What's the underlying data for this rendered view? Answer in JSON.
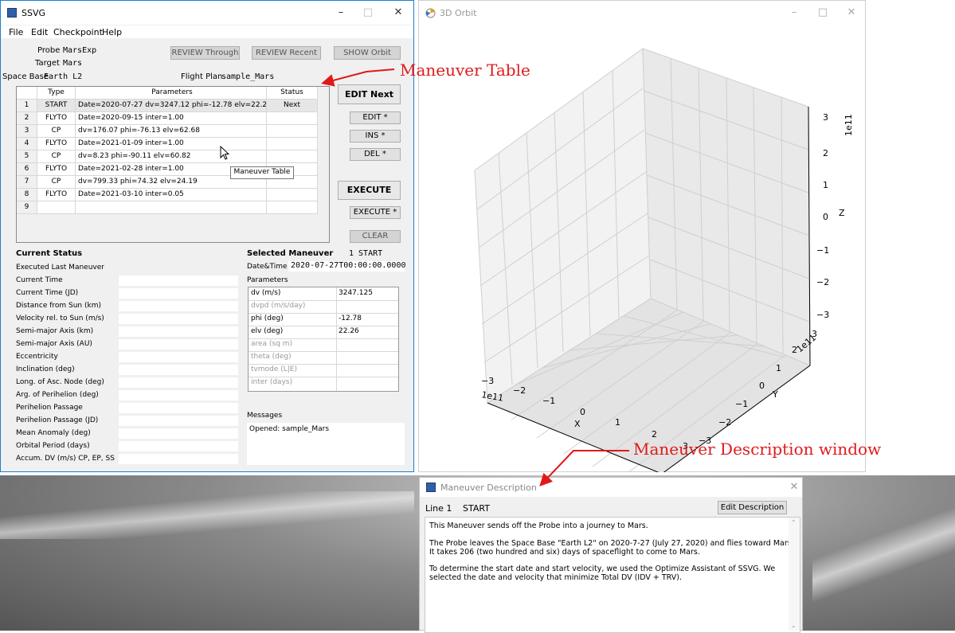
{
  "ssvg": {
    "title": "SSVG",
    "menu": [
      "File",
      "Edit",
      "Checkpoint",
      "Help"
    ],
    "probe_label": "Probe",
    "probe_value": "MarsExp",
    "target_label": "Target",
    "target_value": "Mars",
    "spacebase_label": "Space Base",
    "spacebase_value": "Earth L2",
    "flightplan_label": "Flight Plan",
    "flightplan_value": "sample_Mars",
    "btn_review_through": "REVIEW Through",
    "btn_review_recent": "REVIEW Recent",
    "btn_show_orbit": "SHOW Orbit",
    "table": {
      "headers": [
        "Type",
        "Parameters",
        "Status"
      ],
      "rows": [
        {
          "n": "1",
          "type": "START",
          "params": "Date=2020-07-27 dv=3247.12 phi=-12.78 elv=22.26",
          "status": "Next"
        },
        {
          "n": "2",
          "type": "FLYTO",
          "params": "Date=2020-09-15 inter=1.00",
          "status": ""
        },
        {
          "n": "3",
          "type": "CP",
          "params": "dv=176.07 phi=-76.13 elv=62.68",
          "status": ""
        },
        {
          "n": "4",
          "type": "FLYTO",
          "params": "Date=2021-01-09 inter=1.00",
          "status": ""
        },
        {
          "n": "5",
          "type": "CP",
          "params": "dv=8.23 phi=-90.11 elv=60.82",
          "status": ""
        },
        {
          "n": "6",
          "type": "FLYTO",
          "params": "Date=2021-02-28 inter=1.00",
          "status": ""
        },
        {
          "n": "7",
          "type": "CP",
          "params": "dv=799.33 phi=74.32 elv=24.19",
          "status": ""
        },
        {
          "n": "8",
          "type": "FLYTO",
          "params": "Date=2021-03-10 inter=0.05",
          "status": ""
        },
        {
          "n": "9",
          "type": "",
          "params": "",
          "status": ""
        }
      ]
    },
    "tooltip": "Maneuver Table",
    "btn_edit_next": "EDIT Next",
    "btn_edit": "EDIT *",
    "btn_ins": "INS *",
    "btn_del": "DEL *",
    "btn_execute": "EXECUTE",
    "btn_execute_star": "EXECUTE *",
    "btn_clear": "CLEAR",
    "current_status_title": "Current Status",
    "status_rows": [
      "Executed Last Maneuver",
      "Current Time",
      "Current Time (JD)",
      "Distance from Sun (km)",
      "Velocity rel. to Sun (m/s)",
      "Semi-major Axis (km)",
      "Semi-major Axis (AU)",
      "Eccentricity",
      "Inclination (deg)",
      "Long. of Asc. Node (deg)",
      "Arg. of Perihelion (deg)",
      "Perihelion Passage",
      "Perihelion Passage (JD)",
      "Mean Anomaly (deg)",
      "Orbital Period (days)",
      "Accum. DV (m/s) CP, EP, SS"
    ],
    "selected_title": "Selected Maneuver",
    "selected_value": "1  START",
    "datetime_label": "Date&Time",
    "datetime_value": "2020-07-27T00:00:00.0000",
    "parameters_label": "Parameters",
    "params": [
      {
        "name": "dv (m/s)",
        "value": "3247.125",
        "active": true
      },
      {
        "name": "dvpd (m/s/day)",
        "value": "",
        "active": false
      },
      {
        "name": "phi (deg)",
        "value": "-12.78",
        "active": true
      },
      {
        "name": "elv (deg)",
        "value": "22.26",
        "active": true
      },
      {
        "name": "area (sq m)",
        "value": "",
        "active": false
      },
      {
        "name": "theta (deg)",
        "value": "",
        "active": false
      },
      {
        "name": "tvmode (L|E)",
        "value": "",
        "active": false
      },
      {
        "name": "inter (days)",
        "value": "",
        "active": false
      }
    ],
    "messages_label": "Messages",
    "messages_text": "Opened: sample_Mars"
  },
  "orbit": {
    "title": "3D Orbit",
    "z_ticks": [
      "3",
      "2",
      "1",
      "0",
      "−1",
      "−2",
      "−3"
    ],
    "z_label": "Z",
    "z_exp": "1e11",
    "y_ticks": [
      "3",
      "2",
      "1",
      "0",
      "−1",
      "−2",
      "−3"
    ],
    "y_label": "Y",
    "y_exp": "1e11",
    "x_ticks": [
      "−3",
      "−2",
      "−1",
      "0",
      "1",
      "2",
      "3"
    ],
    "x_label": "X",
    "x_exp": "1e11"
  },
  "desc": {
    "title": "Maneuver Description",
    "line_label": "Line 1",
    "line_type": "START",
    "edit_button": "Edit Description",
    "p1": "This Maneuver sends off the Probe into a journey to Mars.",
    "p2a": "The Probe leaves the Space Base \"Earth L2\" on 2020-7-27 (July 27, 2020) and flies toward Mars.",
    "p2b": "It takes 206 (two hundred and six) days of spaceflight to come to Mars.",
    "p3a": "To determine the start date and start velocity, we used the Optimize Assistant of SSVG.  We",
    "p3b": "selected the date and velocity that minimize Total DV (IDV + TRV)."
  },
  "annotations": {
    "maneuver_table": "Maneuver Table",
    "description_window": "Maneuver Description window",
    "accent": "#e0191a"
  }
}
